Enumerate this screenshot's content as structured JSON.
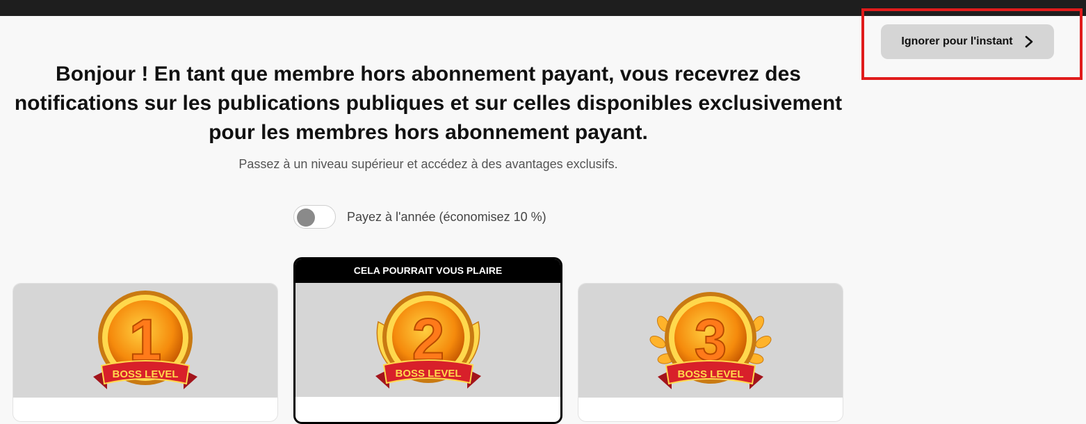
{
  "skip": {
    "label": "Ignorer pour l'instant",
    "icon": "chevron-right-icon"
  },
  "header": {
    "title": "Bonjour ! En tant que membre hors abonnement payant, vous recevrez des notifications sur les publications publiques et sur celles disponibles exclusivement pour les membres hors abonnement payant.",
    "subtitle": "Passez à un niveau supérieur et accédez à des avantages exclusifs."
  },
  "billing": {
    "label": "Payez à l'année (économisez 10 %)",
    "annual_enabled": false
  },
  "tiers": [
    {
      "badge_number": "1",
      "badge_text": "BOSS LEVEL"
    },
    {
      "badge_number": "2",
      "badge_text": "BOSS LEVEL",
      "featured_label": "CELA POURRAIT VOUS PLAIRE"
    },
    {
      "badge_number": "3",
      "badge_text": "BOSS LEVEL"
    }
  ],
  "colors": {
    "highlight": "#e01b1b",
    "medal_gold": "#f5a623",
    "ribbon_red": "#d8202a"
  }
}
